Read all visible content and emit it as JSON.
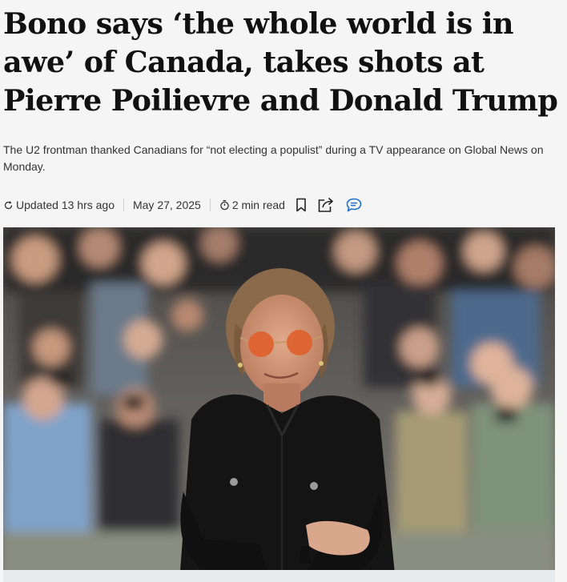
{
  "article": {
    "headline": "Bono says ‘the whole world is in awe’ of Canada, takes shots at Pierre Poilievre and Donald Trump",
    "deck": "The U2 frontman thanked Canadians for “not electing a populist” during a TV appearance on Global News on Monday.",
    "meta": {
      "updated": "Updated 13 hrs ago",
      "date": "May 27, 2025",
      "read_time": "2 min read"
    },
    "icons": {
      "updated": "refresh-clock-icon",
      "read_time": "timer-icon",
      "bookmark": "bookmark-icon",
      "share": "share-icon",
      "comments": "comment-icon"
    },
    "colors": {
      "accent": "#1f6fd1",
      "text": "#111111",
      "muted": "#333333"
    }
  }
}
